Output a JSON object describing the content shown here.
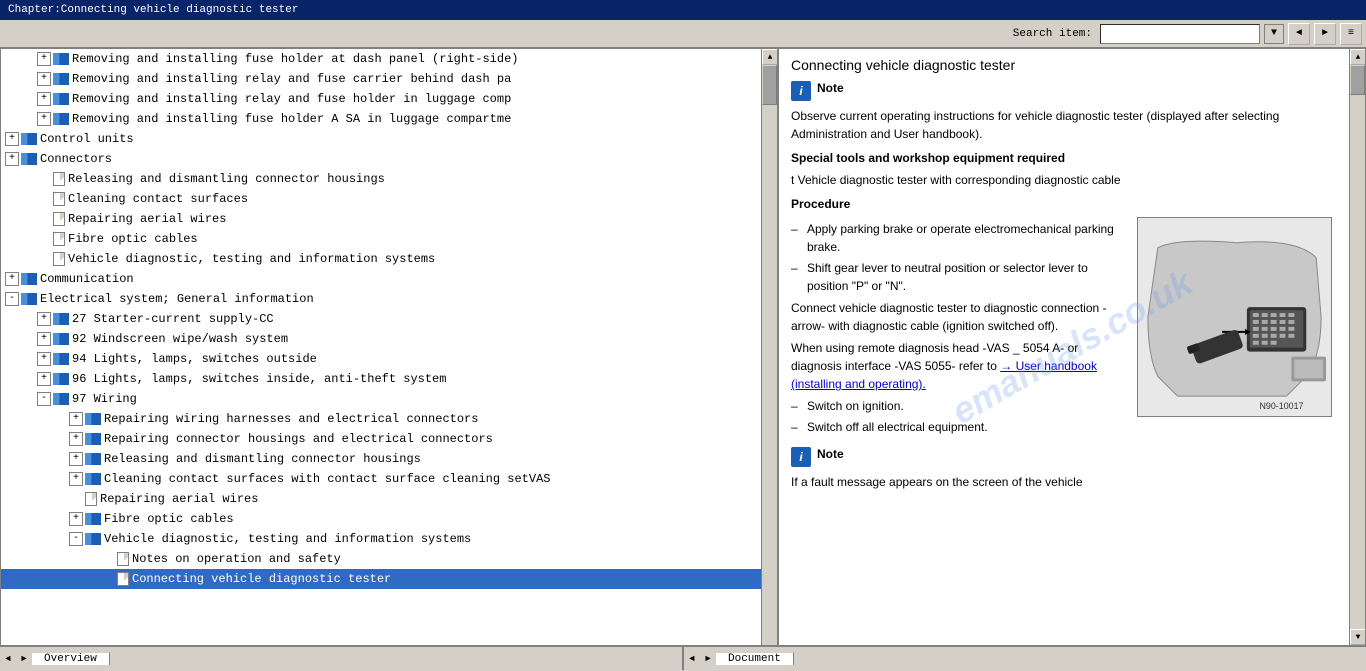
{
  "titlebar": {
    "text": "Chapter:Connecting vehicle diagnostic tester"
  },
  "toolbar": {
    "search_label": "Search item:",
    "search_placeholder": "",
    "btn_prev": "◄",
    "btn_next": "►",
    "btn_menu": "☰"
  },
  "toc": {
    "items": [
      {
        "id": 1,
        "indent": 1,
        "type": "expand",
        "expand": "+",
        "icon": "book",
        "text": "Removing and installing fuse holder at dash panel (right-side)"
      },
      {
        "id": 2,
        "indent": 1,
        "type": "expand",
        "expand": "+",
        "icon": "book",
        "text": "Removing and installing relay and fuse carrier behind dash pa"
      },
      {
        "id": 3,
        "indent": 1,
        "type": "expand",
        "expand": "+",
        "icon": "book",
        "text": "Removing and installing relay and fuse holder in luggage comp"
      },
      {
        "id": 4,
        "indent": 1,
        "type": "expand",
        "expand": "+",
        "icon": "book",
        "text": "Removing and installing fuse holder A SA in luggage compartme"
      },
      {
        "id": 5,
        "indent": 0,
        "type": "expand",
        "expand": "+",
        "icon": "book",
        "text": "Control units"
      },
      {
        "id": 6,
        "indent": 0,
        "type": "expand",
        "expand": "+",
        "icon": "book",
        "text": "Connectors"
      },
      {
        "id": 7,
        "indent": 1,
        "type": "doc",
        "icon": "doc",
        "text": "Releasing and dismantling connector housings"
      },
      {
        "id": 8,
        "indent": 1,
        "type": "doc",
        "icon": "doc",
        "text": "Cleaning contact surfaces"
      },
      {
        "id": 9,
        "indent": 1,
        "type": "doc",
        "icon": "doc",
        "text": "Repairing aerial wires"
      },
      {
        "id": 10,
        "indent": 1,
        "type": "doc",
        "icon": "doc",
        "text": "Fibre optic cables"
      },
      {
        "id": 11,
        "indent": 1,
        "type": "doc",
        "icon": "doc",
        "text": "Vehicle diagnostic, testing and information systems"
      },
      {
        "id": 12,
        "indent": 0,
        "type": "expand",
        "expand": "+",
        "icon": "book",
        "text": "Communication"
      },
      {
        "id": 13,
        "indent": 0,
        "type": "expand",
        "expand": "-",
        "icon": "book",
        "text": "Electrical system; General information"
      },
      {
        "id": 14,
        "indent": 1,
        "type": "expand",
        "expand": "+",
        "icon": "book",
        "text": "27 Starter-current supply-CC"
      },
      {
        "id": 15,
        "indent": 1,
        "type": "expand",
        "expand": "+",
        "icon": "book",
        "text": "92 Windscreen wipe/wash system"
      },
      {
        "id": 16,
        "indent": 1,
        "type": "expand",
        "expand": "+",
        "icon": "book",
        "text": "94 Lights, lamps, switches outside"
      },
      {
        "id": 17,
        "indent": 1,
        "type": "expand",
        "expand": "+",
        "icon": "book",
        "text": "96 Lights, lamps, switches inside, anti-theft system"
      },
      {
        "id": 18,
        "indent": 1,
        "type": "expand",
        "expand": "-",
        "icon": "book",
        "text": "97 Wiring"
      },
      {
        "id": 19,
        "indent": 2,
        "type": "expand",
        "expand": "+",
        "icon": "book",
        "text": "Repairing wiring harnesses and electrical connectors"
      },
      {
        "id": 20,
        "indent": 2,
        "type": "expand",
        "expand": "+",
        "icon": "book",
        "text": "Repairing connector housings and electrical connectors"
      },
      {
        "id": 21,
        "indent": 2,
        "type": "expand",
        "expand": "+",
        "icon": "book",
        "text": "Releasing and dismantling connector housings"
      },
      {
        "id": 22,
        "indent": 2,
        "type": "expand",
        "expand": "+",
        "icon": "book",
        "text": "Cleaning contact surfaces with contact surface cleaning setVAS"
      },
      {
        "id": 23,
        "indent": 2,
        "type": "doc",
        "icon": "doc",
        "text": "Repairing aerial wires"
      },
      {
        "id": 24,
        "indent": 2,
        "type": "expand",
        "expand": "+",
        "icon": "book",
        "text": "Fibre optic cables"
      },
      {
        "id": 25,
        "indent": 2,
        "type": "expand",
        "expand": "-",
        "icon": "book",
        "text": "Vehicle diagnostic, testing and information systems"
      },
      {
        "id": 26,
        "indent": 3,
        "type": "doc",
        "icon": "doc",
        "text": "Notes on operation and safety"
      },
      {
        "id": 27,
        "indent": 3,
        "type": "doc",
        "icon": "doc",
        "text": "Connecting vehicle diagnostic tester",
        "selected": true
      }
    ]
  },
  "document": {
    "title": "Connecting vehicle diagnostic tester",
    "note1_label": "Note",
    "note1_text": "Observe current operating instructions for vehicle diagnostic tester (displayed after selecting Administration and User handbook).",
    "special_tools_label": "Special tools and workshop equipment required",
    "tool_item": "t  Vehicle diagnostic tester with corresponding diagnostic cable",
    "procedure_label": "Procedure",
    "steps": [
      "Apply parking brake or operate electromechanical parking brake.",
      "Shift gear lever to neutral position or selector lever to position \"P\" or \"N\".",
      "Connect vehicle diagnostic tester to diagnostic connection - arrow- with diagnostic cable (ignition switched off).",
      "When using remote diagnosis head -VAS _ 5054 A- or diagnosis interface -VAS 5055- refer to",
      "Switch on ignition.",
      "Switch off all electrical equipment."
    ],
    "link_text": "→ User handbook (installing and operating).",
    "note2_label": "Note",
    "note2_text": "If a fault message appears on the screen of the vehicle",
    "image_label": "N90-10017",
    "arrow_diagnostic_text": "arrow - With diagnostic"
  },
  "statusbar": {
    "left_tab": "Overview",
    "right_tab": "Document",
    "scroll_left": "◄",
    "scroll_right": "►"
  }
}
